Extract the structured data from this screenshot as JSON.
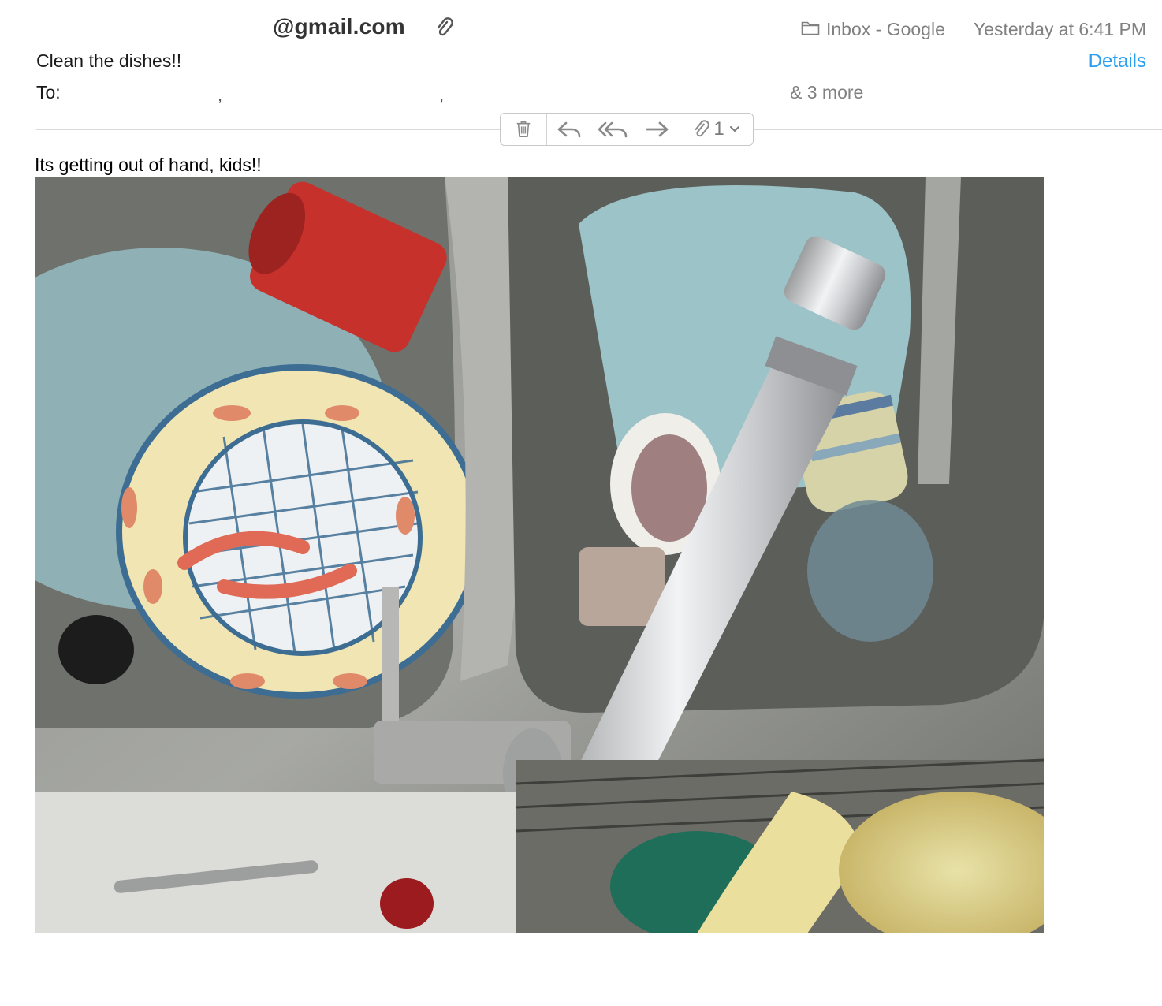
{
  "header": {
    "from": "@gmail.com",
    "mailbox": "Inbox - Google",
    "date": "Yesterday at 6:41 PM",
    "subject": "Clean the dishes!!",
    "details_label": "Details",
    "to_label": "To:",
    "more_recipients": "& 3 more"
  },
  "toolbar": {
    "buttons": [
      "trash-icon",
      "reply-icon",
      "reply-all-icon",
      "forward-icon",
      "paperclip-icon"
    ],
    "attachment_count": "1"
  },
  "message": {
    "body": "Its getting out of hand, kids!!"
  },
  "colors": {
    "link": "#2a9ff0",
    "muted": "#808080"
  }
}
